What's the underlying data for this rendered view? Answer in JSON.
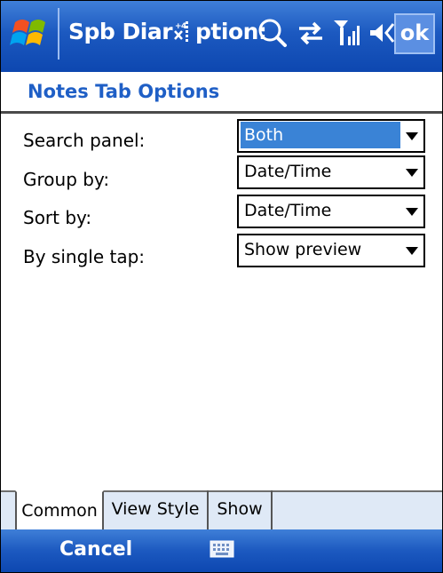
{
  "titlebar": {
    "title": "Spb Diar",
    "title_suffix": "ption:",
    "ok_label": "ok"
  },
  "page": {
    "title": "Notes Tab Options"
  },
  "form": {
    "search_panel": {
      "label": "Search panel:",
      "value": "Both"
    },
    "group_by": {
      "label": "Group by:",
      "value": "Date/Time"
    },
    "sort_by": {
      "label": "Sort by:",
      "value": "Date/Time"
    },
    "single_tap": {
      "label": "By single tap:",
      "value": "Show preview"
    }
  },
  "tabs": [
    {
      "label": "Common"
    },
    {
      "label": "View Style"
    },
    {
      "label": "Show"
    }
  ],
  "softkeys": {
    "left": "Cancel"
  },
  "colors": {
    "titlebar": "#1c59c0",
    "accent_text": "#1f5fc6",
    "selection": "#3a83d6",
    "tab_strip": "#dfe9f6"
  },
  "icons": [
    "windows-flag-icon",
    "data-connection-icon",
    "search-icon",
    "sync-icon",
    "signal-icon",
    "volume-icon",
    "keyboard-icon"
  ]
}
